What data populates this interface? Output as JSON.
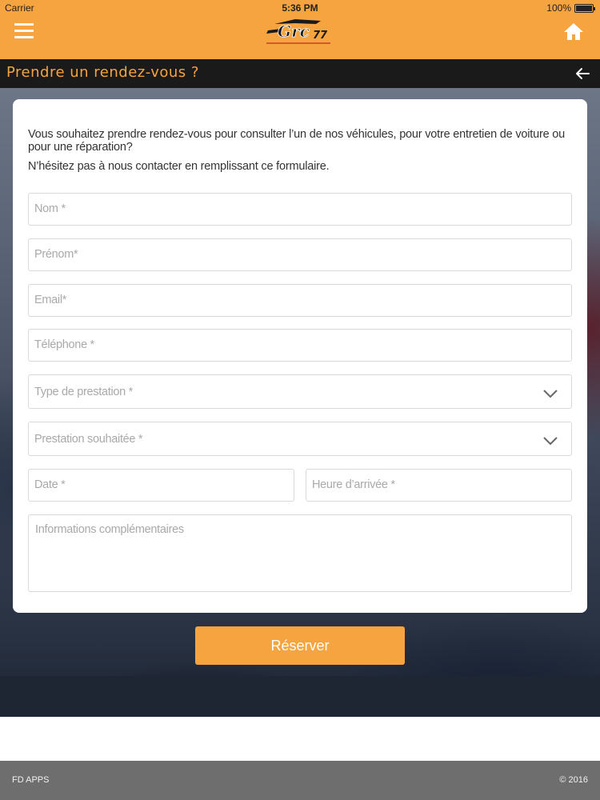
{
  "status_bar": {
    "carrier": "Carrier",
    "time": "5:36 PM",
    "battery": "100%"
  },
  "header": {
    "logo_text": "Grc 77",
    "menu_icon": "hamburger-menu-icon",
    "home_icon": "home-icon",
    "color": "#f6a43f"
  },
  "titlebar": {
    "title": "Prendre un rendez-vous ?",
    "back_icon": "arrow-left-icon"
  },
  "form": {
    "intro_line_1": "Vous souhaitez prendre rendez-vous pour consulter l’un de nos véhicules, pour votre entretien de voiture ou pour une réparation?",
    "intro_line_2": "N’hésitez pas à nous contacter en remplissant ce formulaire.",
    "fields": {
      "nom": "Nom *",
      "prenom": "Prénom*",
      "email": "Email*",
      "telephone": "Téléphone *",
      "type_prestation": "Type de prestation *",
      "prestation_souhaitee": "Prestation souhaitée *",
      "date": "Date *",
      "heure": "Heure d’arrivée *",
      "informations": "Informations complémentaires"
    },
    "submit_label": "Réserver"
  },
  "footer": {
    "left": "FD APPS",
    "right": "© 2016"
  }
}
